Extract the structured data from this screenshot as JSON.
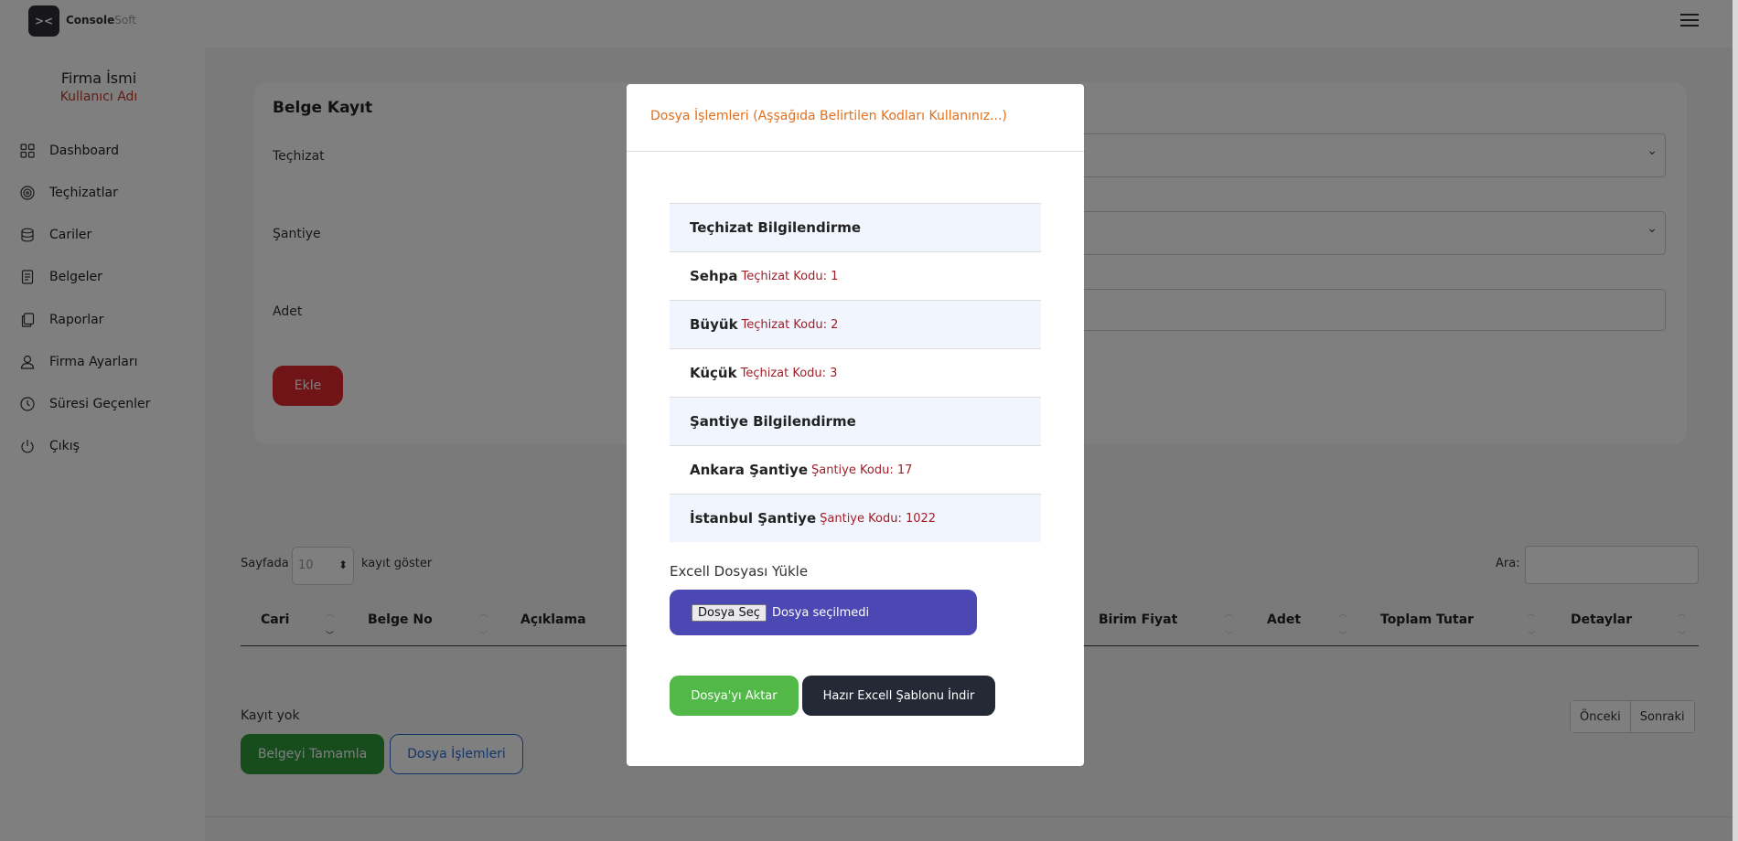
{
  "brand": {
    "logo_glyph": "><",
    "name_bold": "Console",
    "name_light": "Soft"
  },
  "sidebar": {
    "company": "Firma İsmi",
    "user": "Kullanıcı Adı",
    "items": [
      {
        "label": "Dashboard",
        "icon": "grid-icon"
      },
      {
        "label": "Teçhizatlar",
        "icon": "target-icon"
      },
      {
        "label": "Cariler",
        "icon": "database-icon"
      },
      {
        "label": "Belgeler",
        "icon": "document-icon"
      },
      {
        "label": "Raporlar",
        "icon": "copy-icon"
      },
      {
        "label": "Firma Ayarları",
        "icon": "user-icon"
      },
      {
        "label": "Süresi Geçenler",
        "icon": "clock-icon"
      },
      {
        "label": "Çıkış",
        "icon": "power-icon"
      }
    ]
  },
  "form": {
    "title": "Belge Kayıt",
    "label_equipment": "Teçhizat",
    "label_site": "Şantiye",
    "label_qty": "Adet",
    "add_button": "Ekle"
  },
  "table": {
    "length_prefix": "Sayfada",
    "length_value": "10",
    "length_suffix": "kayıt göster",
    "search_label": "Ara:",
    "columns": [
      "Cari",
      "Belge No",
      "Açıklama",
      "Birim Fiyat",
      "Adet",
      "Toplam Tutar",
      "Detaylar"
    ],
    "empty": "Kayıt yok",
    "prev": "Önceki",
    "next": "Sonraki"
  },
  "actions": {
    "complete": "Belgeyi Tamamla",
    "file_ops": "Dosya İşlemleri"
  },
  "modal": {
    "title": "Dosya İşlemleri (Aşşağıda Belirtilen Kodları Kullanınız...)",
    "rows": [
      {
        "name": "Teçhizat Bilgilendirme",
        "code": ""
      },
      {
        "name": "Sehpa",
        "code": "Teçhizat Kodu: 1"
      },
      {
        "name": "Büyük",
        "code": "Teçhizat Kodu: 2"
      },
      {
        "name": "Küçük",
        "code": "Teçhizat Kodu: 3"
      },
      {
        "name": "Şantiye Bilgilendirme",
        "code": ""
      },
      {
        "name": "Ankara Şantiye",
        "code": "Şantiye Kodu: 17"
      },
      {
        "name": "İstanbul Şantiye",
        "code": "Şantiye Kodu: 1022"
      }
    ],
    "upload_label": "Excell Dosyası Yükle",
    "file_button": "Dosya Seç",
    "file_status": "Dosya seçilmedi",
    "import_button": "Dosya'yı Aktar",
    "template_button": "Hazır Excell Şablonu İndir"
  },
  "colors": {
    "accent_orange": "#e0701d",
    "code_red": "#a01e28",
    "upload_purple": "#4b48b4",
    "success_green": "#52b848",
    "danger_red": "#e0282f",
    "dark": "#232a35"
  }
}
